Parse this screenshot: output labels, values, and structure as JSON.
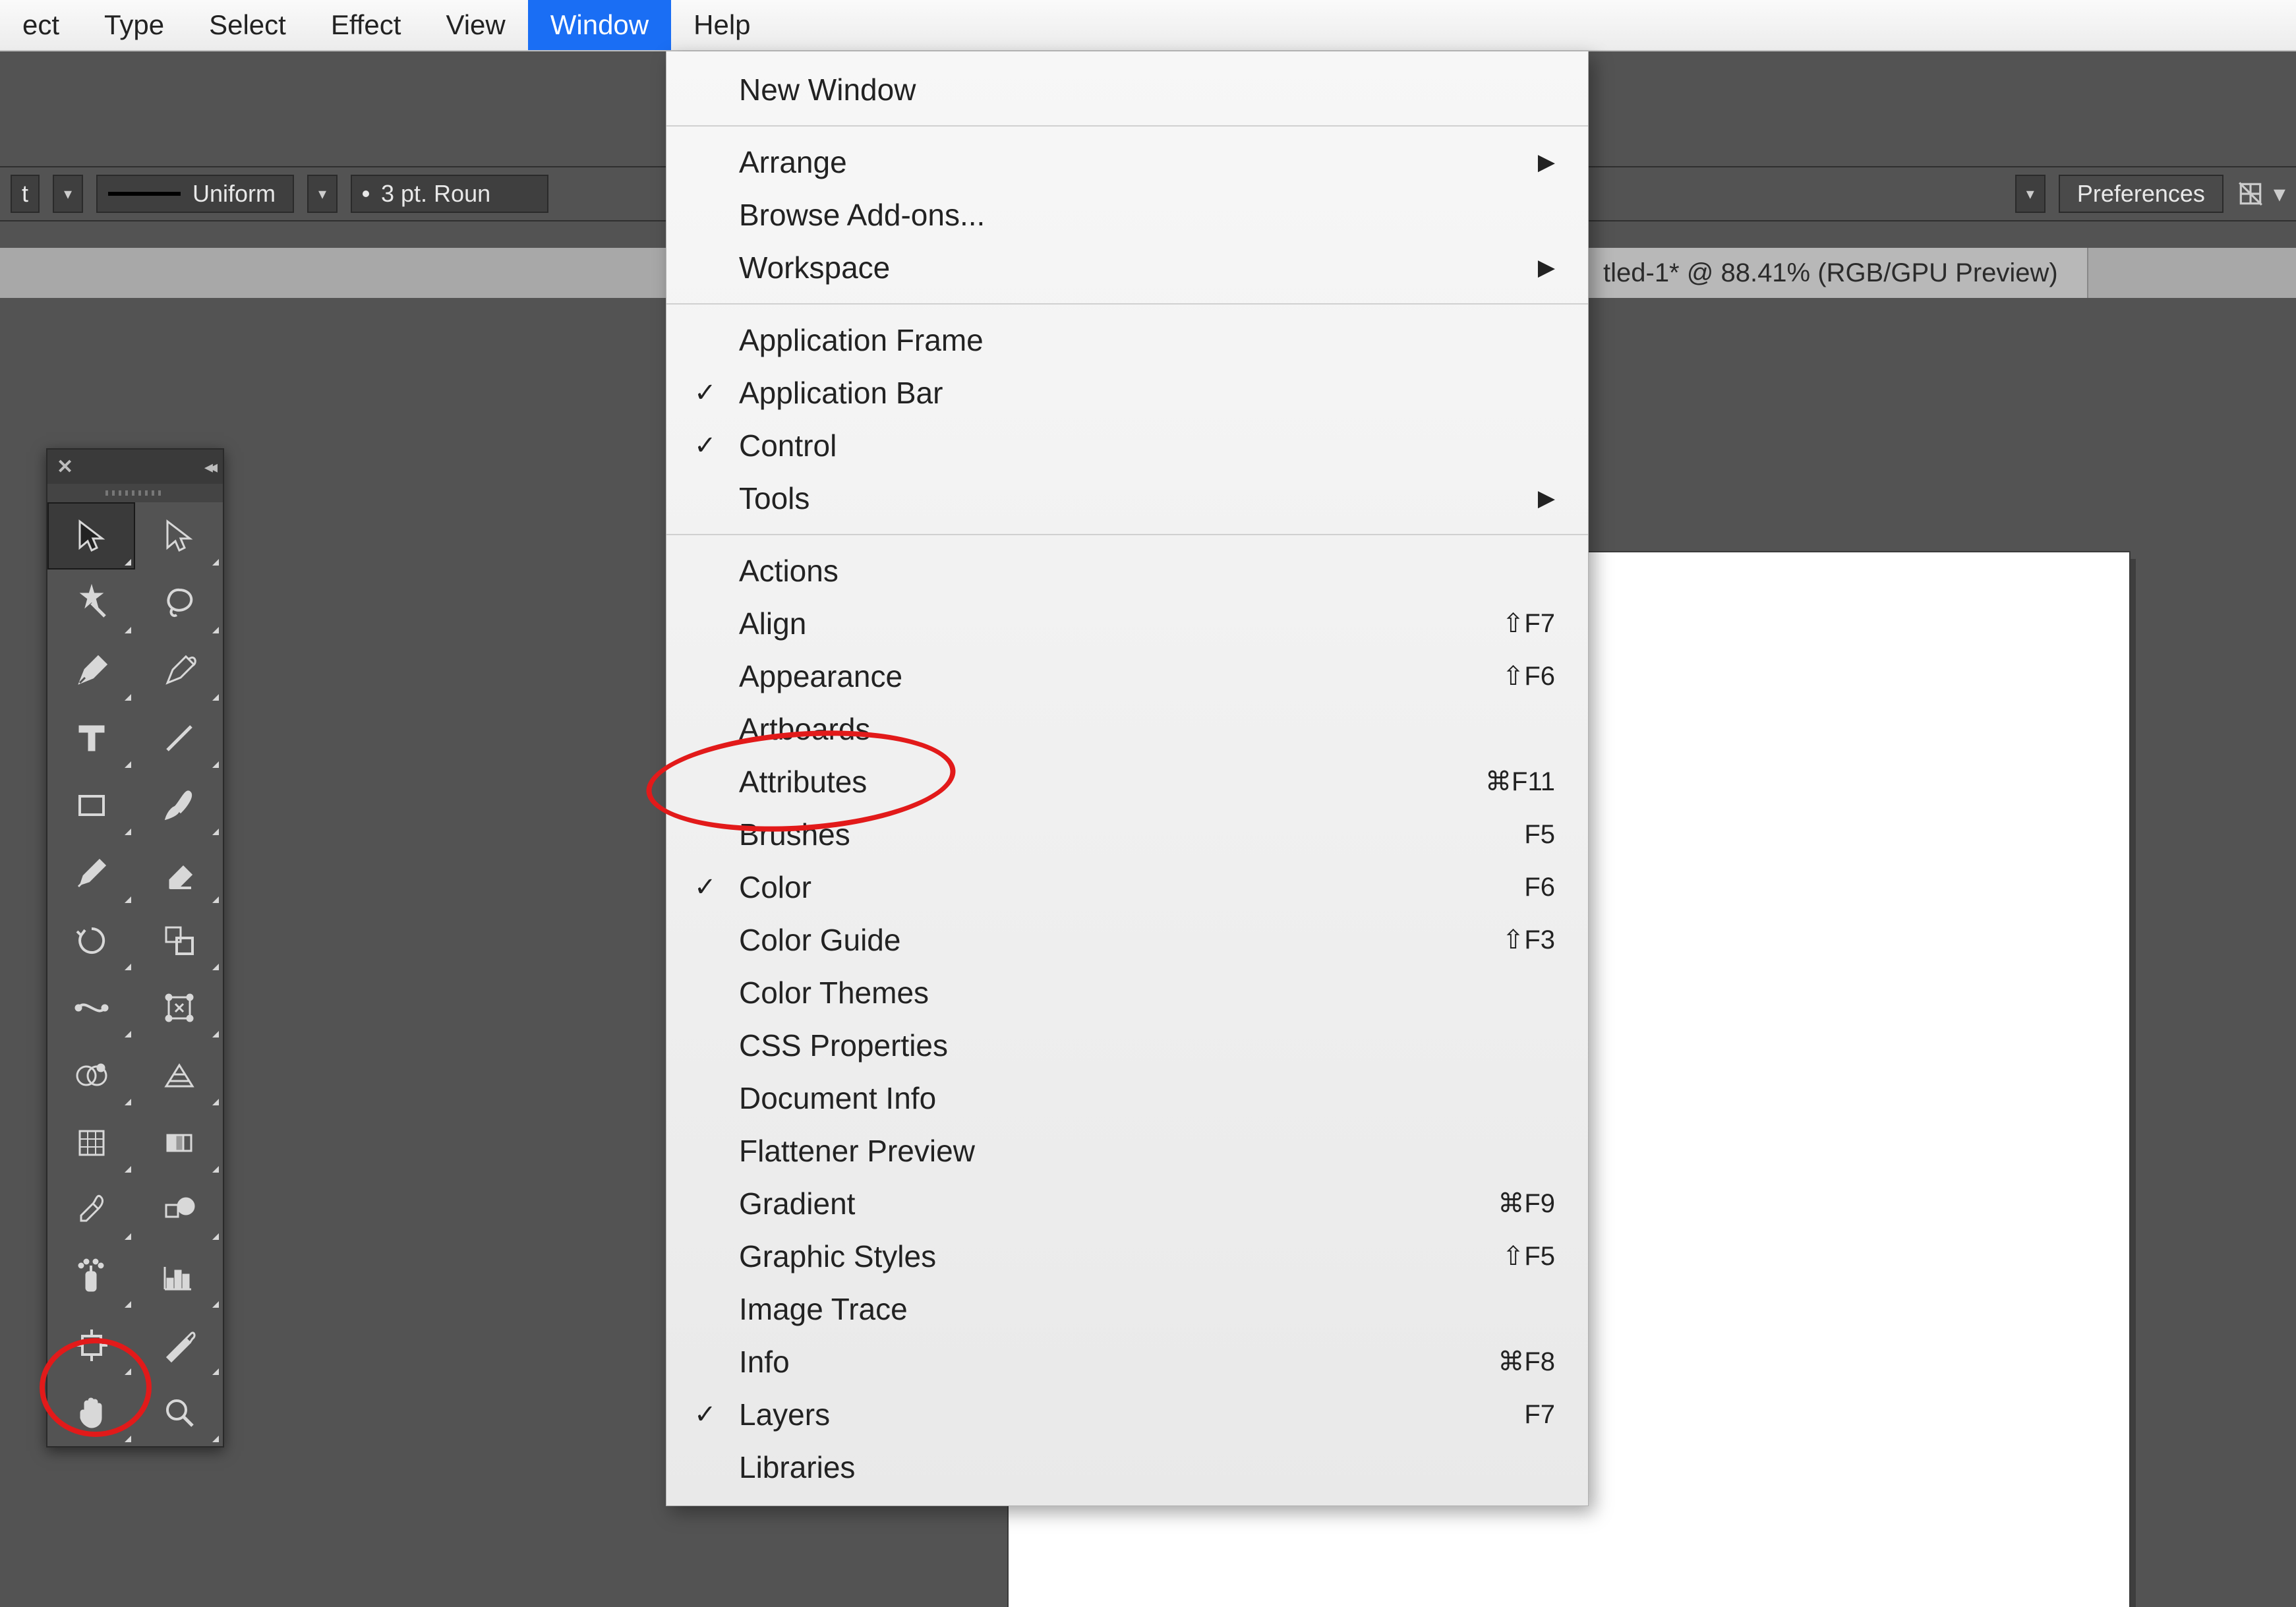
{
  "menubar": {
    "items": [
      "ect",
      "Type",
      "Select",
      "Effect",
      "View",
      "Window",
      "Help"
    ],
    "selected_index": 5
  },
  "control_bar": {
    "stroke_profile": "Uniform",
    "brush_label": "3 pt. Roun",
    "pref_button": "Preferences"
  },
  "doc_tab": {
    "title": "tled-1* @ 88.41% (RGB/GPU Preview)"
  },
  "dropdown": {
    "groups": [
      [
        {
          "label": "New Window"
        }
      ],
      [
        {
          "label": "Arrange",
          "submenu": true
        },
        {
          "label": "Browse Add-ons..."
        },
        {
          "label": "Workspace",
          "submenu": true
        }
      ],
      [
        {
          "label": "Application Frame"
        },
        {
          "label": "Application Bar",
          "checked": true
        },
        {
          "label": "Control",
          "checked": true
        },
        {
          "label": "Tools",
          "submenu": true
        }
      ],
      [
        {
          "label": "Actions"
        },
        {
          "label": "Align",
          "shortcut": "⇧F7"
        },
        {
          "label": "Appearance",
          "shortcut": "⇧F6"
        },
        {
          "label": "Artboards"
        },
        {
          "label": "Attributes",
          "shortcut": "⌘F11"
        },
        {
          "label": "Brushes",
          "shortcut": "F5"
        },
        {
          "label": "Color",
          "checked": true,
          "shortcut": "F6"
        },
        {
          "label": "Color Guide",
          "shortcut": "⇧F3"
        },
        {
          "label": "Color Themes"
        },
        {
          "label": "CSS Properties"
        },
        {
          "label": "Document Info"
        },
        {
          "label": "Flattener Preview"
        },
        {
          "label": "Gradient",
          "shortcut": "⌘F9"
        },
        {
          "label": "Graphic Styles",
          "shortcut": "⇧F5"
        },
        {
          "label": "Image Trace"
        },
        {
          "label": "Info",
          "shortcut": "⌘F8"
        },
        {
          "label": "Layers",
          "checked": true,
          "shortcut": "F7"
        },
        {
          "label": "Libraries"
        }
      ]
    ]
  },
  "tools": [
    {
      "name": "selection-tool",
      "selected": true,
      "sub": true
    },
    {
      "name": "direct-selection-tool",
      "sub": true
    },
    {
      "name": "magic-wand-tool",
      "sub": true
    },
    {
      "name": "lasso-tool",
      "sub": true
    },
    {
      "name": "pen-tool",
      "sub": true
    },
    {
      "name": "curvature-tool",
      "sub": true
    },
    {
      "name": "type-tool",
      "sub": true
    },
    {
      "name": "line-segment-tool",
      "sub": true
    },
    {
      "name": "rectangle-tool",
      "sub": true
    },
    {
      "name": "paintbrush-tool",
      "sub": true
    },
    {
      "name": "pencil-tool",
      "sub": true
    },
    {
      "name": "eraser-tool",
      "sub": true
    },
    {
      "name": "rotate-tool",
      "sub": true
    },
    {
      "name": "scale-tool",
      "sub": true
    },
    {
      "name": "width-tool",
      "sub": true
    },
    {
      "name": "free-transform-tool",
      "sub": true
    },
    {
      "name": "shape-builder-tool",
      "sub": true
    },
    {
      "name": "perspective-grid-tool",
      "sub": true
    },
    {
      "name": "mesh-tool",
      "sub": true
    },
    {
      "name": "gradient-tool",
      "sub": true
    },
    {
      "name": "eyedropper-tool",
      "sub": true
    },
    {
      "name": "blend-tool",
      "sub": true
    },
    {
      "name": "symbol-sprayer-tool",
      "sub": true
    },
    {
      "name": "column-graph-tool",
      "sub": true
    },
    {
      "name": "artboard-tool",
      "sub": true
    },
    {
      "name": "slice-tool",
      "sub": true
    },
    {
      "name": "hand-tool",
      "sub": true
    },
    {
      "name": "zoom-tool",
      "sub": true
    }
  ]
}
